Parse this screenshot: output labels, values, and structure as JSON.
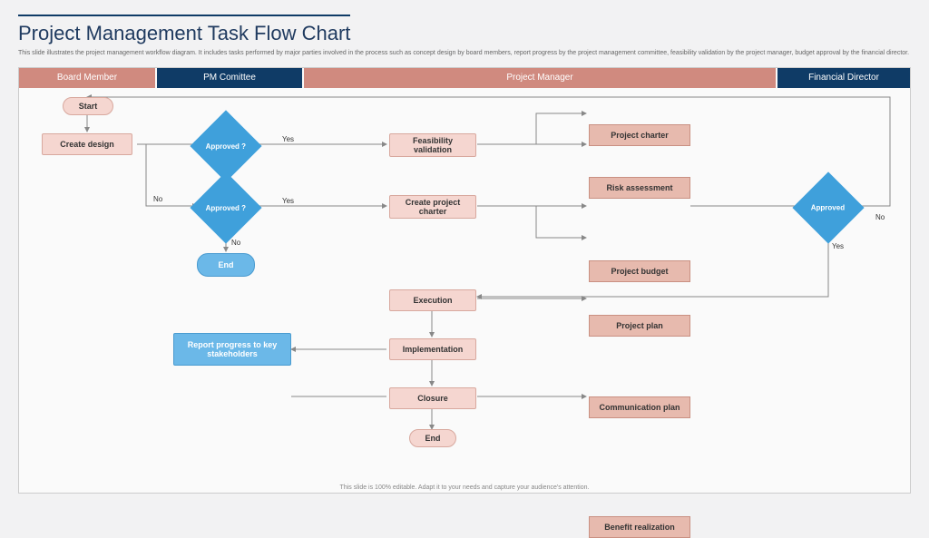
{
  "title": "Project Management Task Flow Chart",
  "subtitle": "This slide illustrates the project management workflow diagram. It includes tasks performed by major parties involved in the process such as concept design by board members, report progress by the project management committee, feasibility validation by the project manager, budget approval by the financial director.",
  "headers": {
    "board": "Board Member",
    "pm": "PM Comittee",
    "mgr": "Project Manager",
    "fin": "Financial Director"
  },
  "nodes": {
    "start": "Start",
    "create_design": "Create design",
    "approved1": "Approved ?",
    "approved2": "Approved ?",
    "approved3": "Approved",
    "end1": "End",
    "end2": "End",
    "feasibility": "Feasibility validation",
    "charter": "Create project charter",
    "execution": "Execution",
    "implementation": "Implementation",
    "closure": "Closure",
    "report": "Report progress to key stakeholders",
    "proj_charter": "Project charter",
    "risk": "Risk assessment",
    "budget": "Project budget",
    "plan": "Project plan",
    "comm": "Communication plan",
    "benefit": "Benefit realization"
  },
  "labels": {
    "yes": "Yes",
    "no": "No"
  },
  "footer": "This slide is 100% editable. Adapt it to your needs and capture your audience's attention."
}
